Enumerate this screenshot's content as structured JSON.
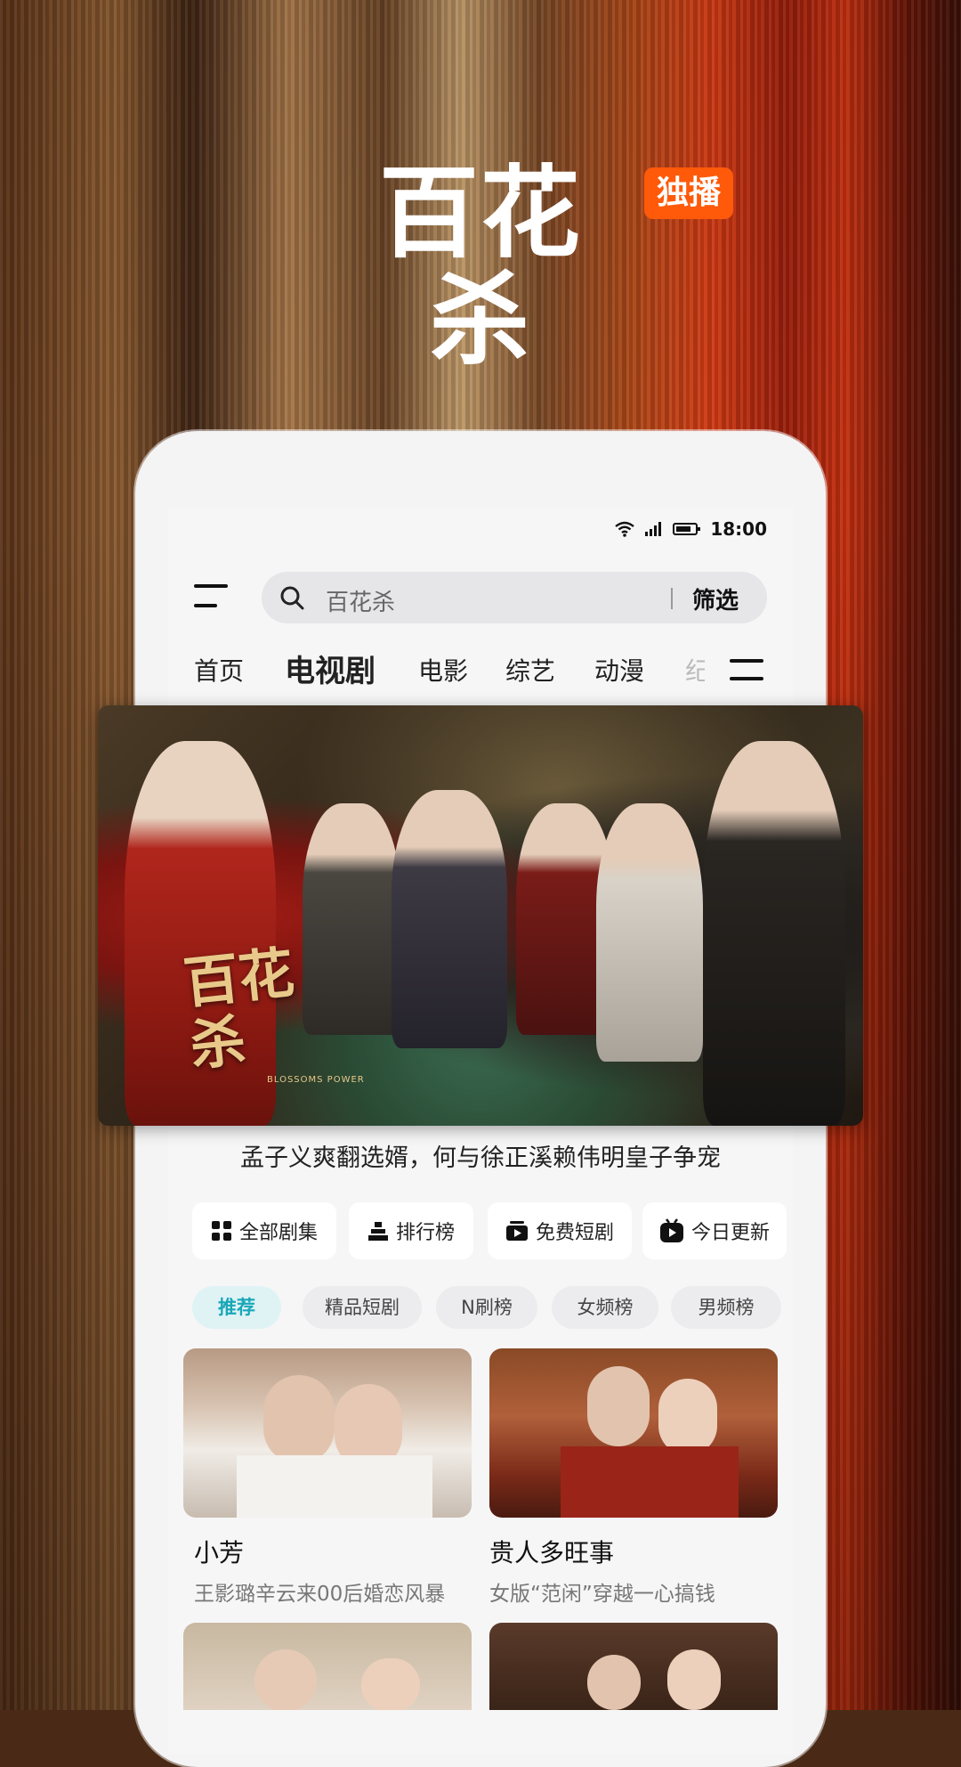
{
  "promo": {
    "title": "百花杀",
    "badge": "独播"
  },
  "status": {
    "time": "18:00"
  },
  "search": {
    "placeholder": "百花杀",
    "filter_label": "筛选"
  },
  "tabs": [
    {
      "label": "首页"
    },
    {
      "label": "电视剧"
    },
    {
      "label": "电影"
    },
    {
      "label": "综艺"
    },
    {
      "label": "动漫"
    },
    {
      "label": "纪"
    }
  ],
  "hero": {
    "logo_text": "百花杀",
    "logo_sub": "BLOSSOMS POWER",
    "headline": "孟子义爽翻选婿，何与徐正溪赖伟明皇子争宠"
  },
  "quick_actions": [
    {
      "label": "全部剧集",
      "icon": "grid-icon"
    },
    {
      "label": "排行榜",
      "icon": "podium-icon"
    },
    {
      "label": "免费短剧",
      "icon": "video-box-icon"
    },
    {
      "label": "今日更新",
      "icon": "tv-play-icon"
    }
  ],
  "chips": [
    {
      "label": "推荐"
    },
    {
      "label": "精品短剧"
    },
    {
      "label": "N刷榜"
    },
    {
      "label": "女频榜"
    },
    {
      "label": "男频榜"
    }
  ],
  "cards": [
    {
      "title": "小芳",
      "subtitle": "王影璐辛云来00后婚恋风暴"
    },
    {
      "title": "贵人多旺事",
      "subtitle": "女版“范闲”穿越一心搞钱"
    }
  ],
  "colors": {
    "accent": "#ff5a0a",
    "chip_active": "#19a7b8"
  }
}
